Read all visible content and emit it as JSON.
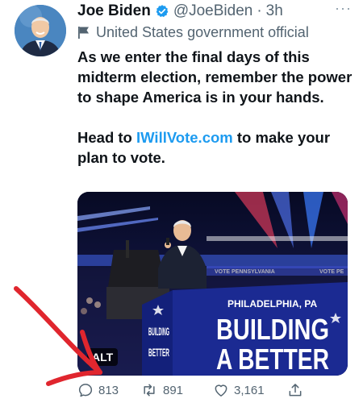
{
  "author": {
    "name": "Joe Biden",
    "handle": "@JoeBiden",
    "separator": "·",
    "time": "3h",
    "label": "United States government official",
    "verified": true
  },
  "tweet": {
    "para1": "As we enter the final days of this midterm election, remember the power to shape America is in your hands.",
    "para2_before": "Head to ",
    "para2_link": "IWillVote.com",
    "para2_after": " to make your plan to vote."
  },
  "media": {
    "alt_badge": "ALT",
    "sign_location": "PHILADELPHIA, PA",
    "sign_line1": "BUILDING",
    "sign_line2": "A BETTER",
    "left_sign_line1": "BUILDING",
    "left_sign_line2": "BETTER",
    "banner_text1": "VOTE PENNSYLVANIA",
    "banner_text2": "VOTE PE"
  },
  "actions": {
    "replies": "813",
    "retweets": "891",
    "likes": "3,161"
  },
  "colors": {
    "accent": "#1d9bf0",
    "annotation": "#e0262e",
    "sign_blue": "#1a2a8a"
  },
  "icons": [
    "verified-badge-icon",
    "flag-icon",
    "more-icon",
    "reply-icon",
    "retweet-icon",
    "like-icon",
    "share-icon"
  ]
}
